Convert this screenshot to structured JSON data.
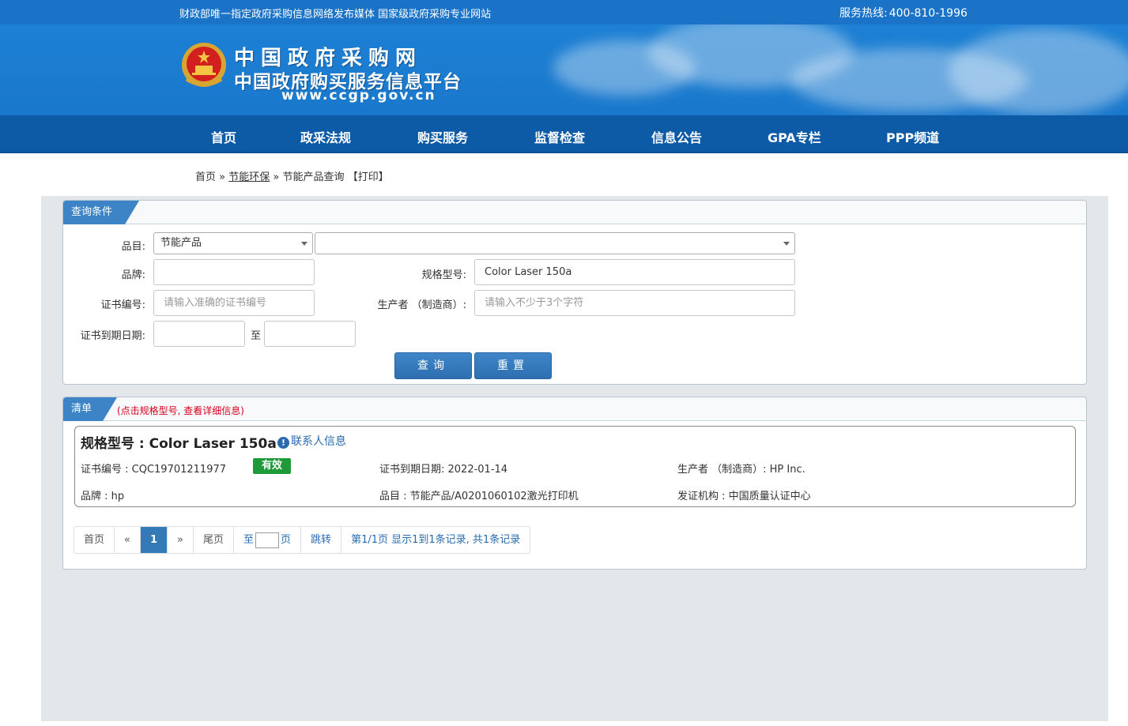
{
  "topbar": {
    "slogan": "财政部唯一指定政府采购信息网络发布媒体 国家级政府采购专业网站",
    "hotline_label": "服务热线:",
    "hotline_number": "400-810-1996"
  },
  "banner": {
    "title": "中国政府采购网",
    "subtitle": "中国政府购买服务信息平台",
    "url": "www.ccgp.gov.cn"
  },
  "nav": {
    "items": [
      "首页",
      "政采法规",
      "购买服务",
      "监督检查",
      "信息公告",
      "GPA专栏",
      "PPP频道"
    ]
  },
  "breadcrumb": {
    "home": "首页",
    "sep": "»",
    "section": "节能环保",
    "current": "节能产品查询",
    "print": "【打印】"
  },
  "query": {
    "tab_label": "查询条件",
    "category_label": "品目:",
    "category_value": "节能产品",
    "subcategory_value": "",
    "brand_label": "品牌:",
    "brand_value": "",
    "model_label": "规格型号:",
    "model_value": "Color Laser 150a",
    "cert_label": "证书编号:",
    "cert_placeholder": "请输入准确的证书编号",
    "maker_label": "生产者 （制造商）:",
    "maker_placeholder": "请输入不少于3个字符",
    "expiry_label": "证书到期日期:",
    "date_to": "至",
    "search_button": "查询",
    "reset_button": "重置"
  },
  "results": {
    "tab_label": "清单",
    "hint": "(点击规格型号, 查看详细信息)",
    "items": [
      {
        "title": "规格型号 : Color Laser 150a",
        "contact": "联系人信息",
        "cert": "证书编号 : CQC19701211977",
        "status": "有效",
        "expiry": "证书到期日期: 2022-01-14",
        "maker": "生产者 （制造商）: HP Inc.",
        "brand": "品牌 : hp",
        "category": "品目 : 节能产品/A0201060102激光打印机",
        "issuer": "发证机构 : 中国质量认证中心"
      }
    ]
  },
  "pager": {
    "first": "首页",
    "prev": "«",
    "current": "1",
    "next": "»",
    "last": "尾页",
    "goto_prefix": "至",
    "goto_suffix": "页",
    "jump": "跳转",
    "summary": "第1/1页  显示1到1条记录, 共1条记录"
  },
  "colors": {
    "topbar": "#1a73c7",
    "nav": "#0d5aa7",
    "tab": "#3d84c6",
    "valid_badge": "#1e9a3b",
    "hint": "#d9001b"
  }
}
